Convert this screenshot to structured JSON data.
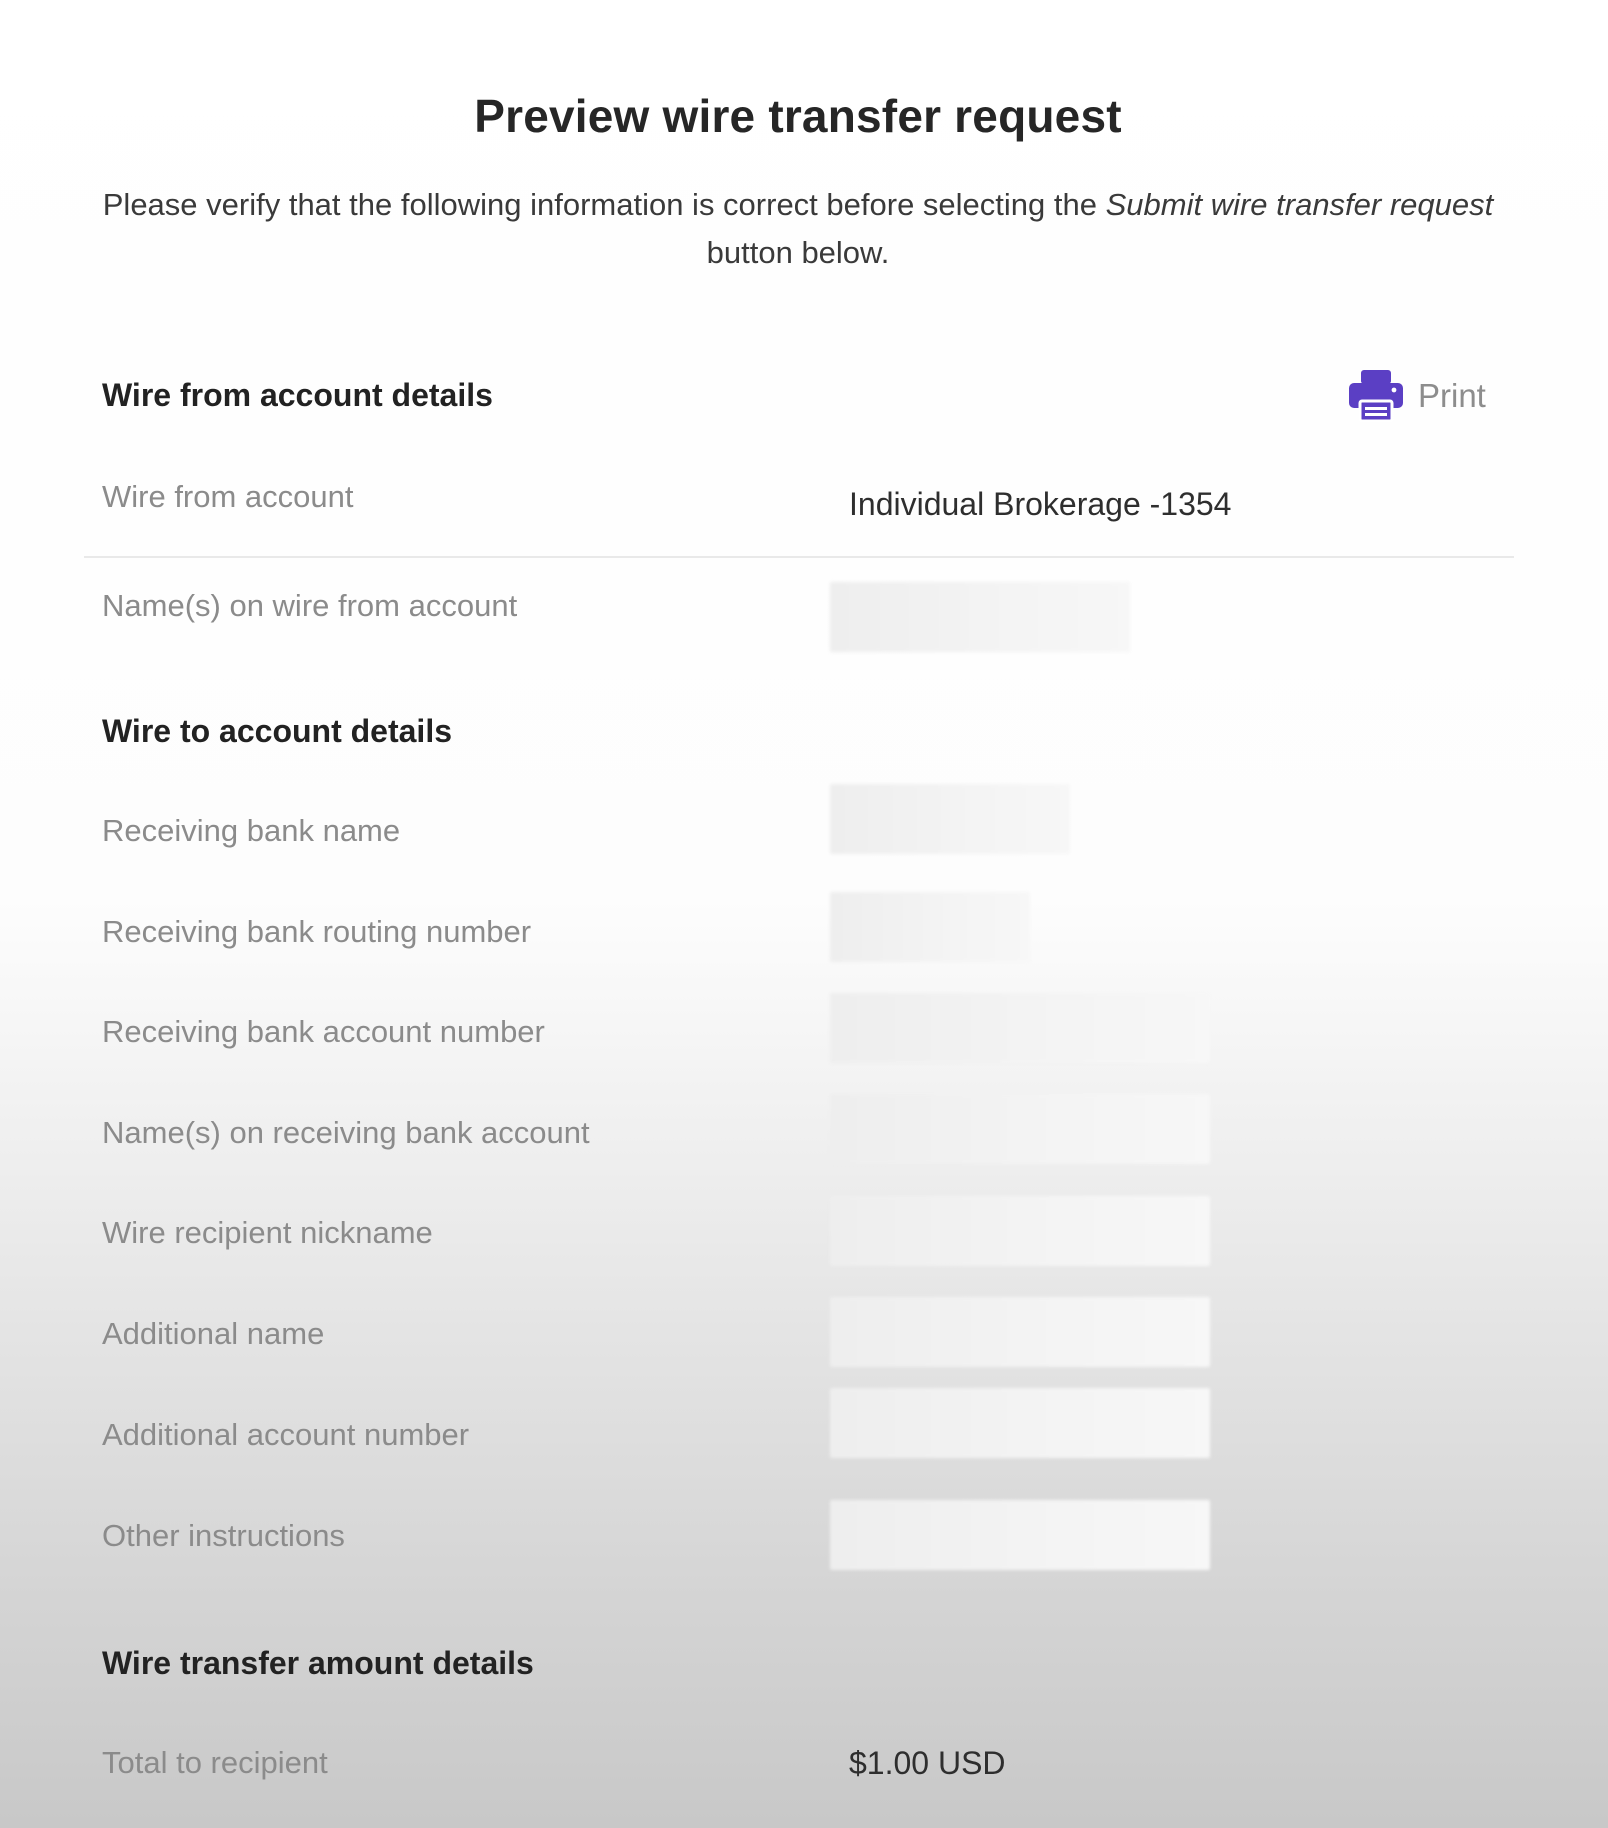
{
  "page": {
    "title": "Preview wire transfer request",
    "intro_before": "Please verify that the following information is correct before selecting the ",
    "intro_emphasis": "Submit wire transfer request",
    "intro_after": " button below."
  },
  "from_section": {
    "heading": "Wire from account details",
    "print_label": "Print",
    "rows": [
      {
        "label": "Wire from account",
        "value": "Individual Brokerage -1354"
      },
      {
        "label": "Name(s) on wire from account",
        "value": ""
      }
    ]
  },
  "to_section": {
    "heading": "Wire to account details",
    "rows": [
      {
        "label": "Receiving bank name",
        "value": ""
      },
      {
        "label": "Receiving bank routing number",
        "value": ""
      },
      {
        "label": "Receiving bank account number",
        "value": ""
      },
      {
        "label": "Name(s) on receiving bank account",
        "value": ""
      },
      {
        "label": "Wire recipient nickname",
        "value": ""
      },
      {
        "label": "Additional name",
        "value": ""
      },
      {
        "label": "Additional account number",
        "value": ""
      },
      {
        "label": "Other instructions",
        "value": ""
      }
    ]
  },
  "amount_section": {
    "heading": "Wire transfer amount details",
    "rows": [
      {
        "label": "Total to recipient",
        "value": "$1.00 USD"
      }
    ]
  },
  "colors": {
    "print_icon": "#5b3fc4",
    "label_text": "#8b8b8b",
    "value_text": "#2e2e2e"
  },
  "icons": {
    "print": "printer-icon"
  }
}
